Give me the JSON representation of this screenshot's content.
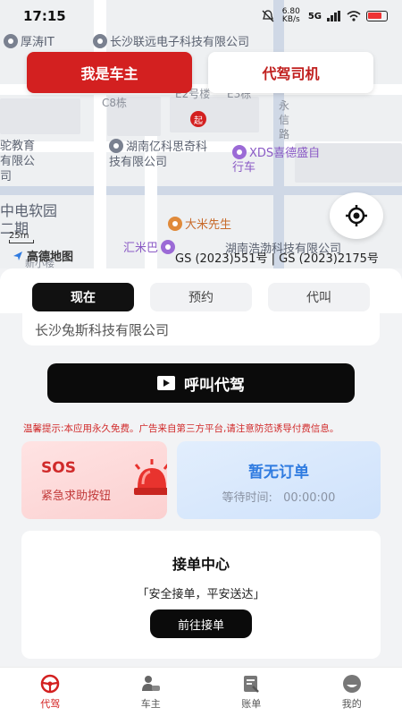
{
  "status_bar": {
    "time": "17:15",
    "net_speed": "6.80 KB/s",
    "network": "5G"
  },
  "role_tabs": {
    "owner": "我是车主",
    "driver": "代驾司机"
  },
  "map": {
    "pois": [
      "厚涛IT",
      "长沙联远电子科技有限公司",
      "C8栋",
      "E2号楼",
      "E3栋",
      "永信路",
      "起",
      "驼教育有限公司",
      "湖南亿科思奇科技有限公司",
      "XDS喜德盛自行车",
      "中电软园二期",
      "大米先生",
      "汇米巴",
      "湖南浩渤科技有限公司",
      "新小楼"
    ],
    "scale": "25m",
    "provider": "高德地图",
    "license": "GS (2023)551号 | GS (2023)2175号"
  },
  "mode_tabs": [
    "现在",
    "预约",
    "代叫"
  ],
  "address": "长沙兔斯科技有限公司",
  "call_button": "呼叫代驾",
  "tip": "温馨提示:本应用永久免费。广告来自第三方平台,请注意防范诱导付费信息。",
  "sos": {
    "title": "SOS",
    "subtitle": "紧急求助按钮"
  },
  "order": {
    "title": "暂无订单",
    "wait_label": "等待时间:",
    "wait_time": "00:00:00"
  },
  "center": {
    "title": "接单中心",
    "slogan": "「安全接单，平安送达」",
    "button": "前往接单"
  },
  "nav": [
    "代驾",
    "车主",
    "账单",
    "我的"
  ],
  "colors": {
    "brand_red": "#d32020",
    "blue": "#2f7be0",
    "black": "#0b0b0b"
  }
}
